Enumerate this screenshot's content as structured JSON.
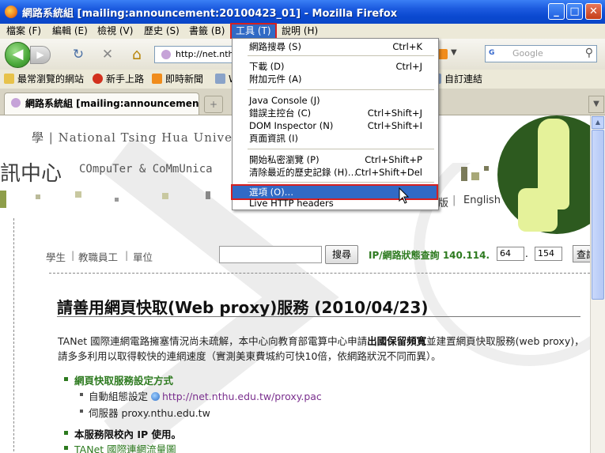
{
  "window": {
    "title": "網路系統組 [mailing:announcement:20100423_01] - Mozilla Firefox",
    "buttons": {
      "minimize": "_",
      "maximize": "□",
      "close": "✕"
    }
  },
  "menubar": {
    "items": [
      {
        "label": "檔案 (F)"
      },
      {
        "label": "編輯 (E)"
      },
      {
        "label": "檢視 (V)"
      },
      {
        "label": "歷史 (S)"
      },
      {
        "label": "書籤 (B)"
      },
      {
        "label": "工具 (T)"
      },
      {
        "label": "說明 (H)"
      }
    ]
  },
  "navbar": {
    "back": "◀",
    "forward": "▶",
    "reload": "↻",
    "stop": "✕",
    "home": "⌂",
    "url": "http://net.nthu",
    "search_placeholder": "Google",
    "search_engine": "G",
    "search_icon": "⚲"
  },
  "bookmarks": {
    "items": [
      {
        "label": "最常瀏覽的網站",
        "icon": "folder-icon",
        "color": "#e7c24a"
      },
      {
        "label": "新手上路",
        "icon": "firefox-icon",
        "color": "#d2311e"
      },
      {
        "label": "即時新聞",
        "icon": "rss-icon",
        "color": "#f08c1c"
      },
      {
        "label": "W",
        "icon": "page-icon",
        "color": "#8aa3c8"
      },
      {
        "label": "自訂連結",
        "icon": "page-icon",
        "color": "#8aa3c8"
      }
    ]
  },
  "tabs": {
    "active": "網路系統組 [mailing:announcement:",
    "new_tab": "+",
    "scroll": "▼"
  },
  "tools_menu": {
    "items": [
      {
        "label": "網路搜尋 (S)",
        "shortcut": "Ctrl+K"
      },
      {
        "label": "下載 (D)",
        "shortcut": "Ctrl+J"
      },
      {
        "label": "附加元件 (A)",
        "shortcut": ""
      },
      {
        "label": "Java Console (J)",
        "shortcut": ""
      },
      {
        "label": "錯誤主控台 (C)",
        "shortcut": "Ctrl+Shift+J"
      },
      {
        "label": "DOM Inspector (N)",
        "shortcut": "Ctrl+Shift+I"
      },
      {
        "label": "頁面資訊 (I)",
        "shortcut": ""
      },
      {
        "label": "開始私密瀏覽 (P)",
        "shortcut": "Ctrl+Shift+P"
      },
      {
        "label": "清除最近的歷史記錄 (H)…",
        "shortcut": "Ctrl+Shift+Del"
      },
      {
        "label": "選項 (O)…",
        "shortcut": ""
      },
      {
        "label": "Live HTTP headers",
        "shortcut": ""
      }
    ]
  },
  "page": {
    "university": "學 | National Tsing Hua University",
    "center_title": "訊中心",
    "center_en": "COmpuTer & CoMmUnica",
    "right_links": {
      "a": "版",
      "b": "English"
    },
    "audience_links": [
      "學生",
      "教職員工",
      "單位"
    ],
    "search_button": "搜尋",
    "ip_query_label": "IP/網路狀態查詢 140.114.",
    "ip_1": "64",
    "ip_2": "154",
    "query_button": "查詢",
    "headline": "請善用網頁快取(Web proxy)服務 (2010/04/23)",
    "paragraph_part1": "TANet 國際連網電路擁塞情況尚未疏解，本中心向教育部電算中心申請",
    "paragraph_bold": "出國保留頻寬",
    "paragraph_part2": "並建置網頁快取服務(web proxy)，請多多利用以取得較快的連網速度（實測美東費城約可快10倍，依網路狀況不同而異）。",
    "list_heading": "網頁快取服務設定方式",
    "auto_config_label": "自動組態設定",
    "auto_config_url": "http://net.nthu.edu.tw/proxy.pac",
    "server_label": "伺服器 proxy.nthu.edu.tw",
    "campus_only": "本服務限校內 IP 使用。",
    "traffic_link": "TANet 國際連網流量圖"
  },
  "colors": {
    "highlight": "#316ac5",
    "red_outline": "#d42020",
    "green": "#2d7a1f",
    "link_purple": "#7a2f8e"
  }
}
